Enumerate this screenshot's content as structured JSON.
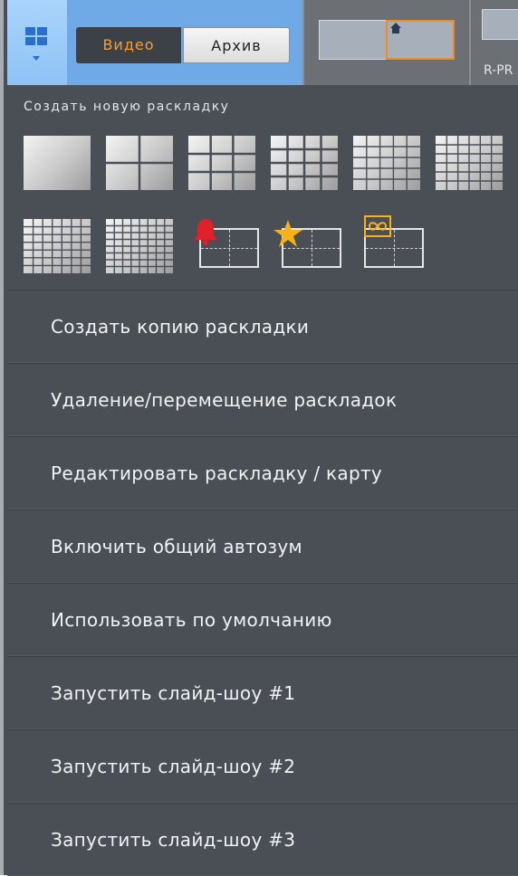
{
  "top_bar": {
    "mode_tabs": {
      "video_label": "Видео",
      "archive_label": "Архив"
    },
    "camera_tab_label": "R-PR"
  },
  "menu": {
    "section_title": "Создать новую раскладку",
    "layout_templates_row1": [
      "1x1",
      "2x2",
      "3x3",
      "4x4",
      "5x5",
      "6x6"
    ],
    "layout_templates_row2": [
      "7x7",
      "8x8",
      "alarm-layout",
      "favorites-layout",
      "infinite-layout"
    ],
    "items": [
      "Создать копию раскладки",
      "Удаление/перемещение раскладок",
      "Редактировать раскладку / карту",
      "Включить общий автозум",
      "Использовать по умолчанию",
      "Запустить слайд-шоу #1",
      "Запустить слайд-шоу #2",
      "Запустить слайд-шоу #3"
    ]
  },
  "colors": {
    "panel_bg": "#4a4f55",
    "accent_blue": "#6fa9e6",
    "accent_orange": "#f2a033",
    "alarm_red": "#e0202a",
    "star_yellow": "#f7b21a"
  }
}
